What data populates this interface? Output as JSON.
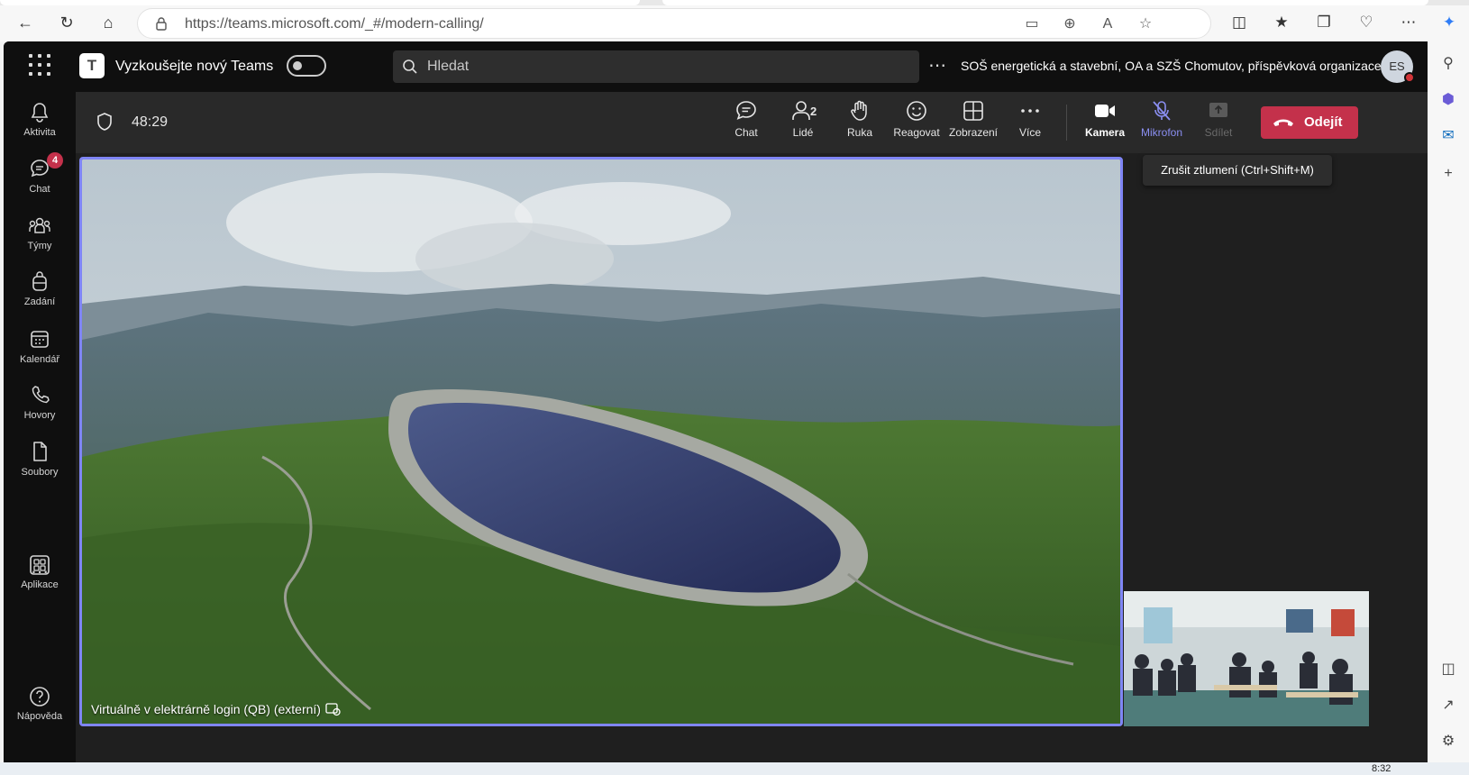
{
  "browser": {
    "url": "https://teams.microsoft.com/_#/modern-calling/"
  },
  "teams": {
    "try_new_label": "Vyzkoušejte nový Teams",
    "search_placeholder": "Hledat",
    "org_name": "SOŠ energetická a stavební, OA a SZŠ Chomutov, příspěvková organizace",
    "avatar_initials": "ES",
    "rail": [
      {
        "label": "Aktivita"
      },
      {
        "label": "Chat",
        "badge": "4"
      },
      {
        "label": "Týmy"
      },
      {
        "label": "Zadání"
      },
      {
        "label": "Kalendář"
      },
      {
        "label": "Hovory"
      },
      {
        "label": "Soubory"
      },
      {
        "label": "Aplikace"
      },
      {
        "label": "Nápověda"
      }
    ]
  },
  "meeting": {
    "timer": "48:29",
    "tools": {
      "chat": "Chat",
      "people": "Lidé",
      "people_count": "2",
      "hand": "Ruka",
      "react": "Reagovat",
      "view": "Zobrazení",
      "more": "Více",
      "camera": "Kamera",
      "mic": "Mikrofon",
      "share": "Sdílet"
    },
    "leave_label": "Odejít",
    "tooltip": "Zrušit ztlumení (Ctrl+Shift+M)",
    "presenter_caption": "Virtuálně v elektrárně login (QB) (externí)"
  },
  "taskbar": {
    "clock": "8:32"
  },
  "colors": {
    "accent": "#7f85f5",
    "leave": "#c4314b",
    "badge": "#c4314b"
  }
}
